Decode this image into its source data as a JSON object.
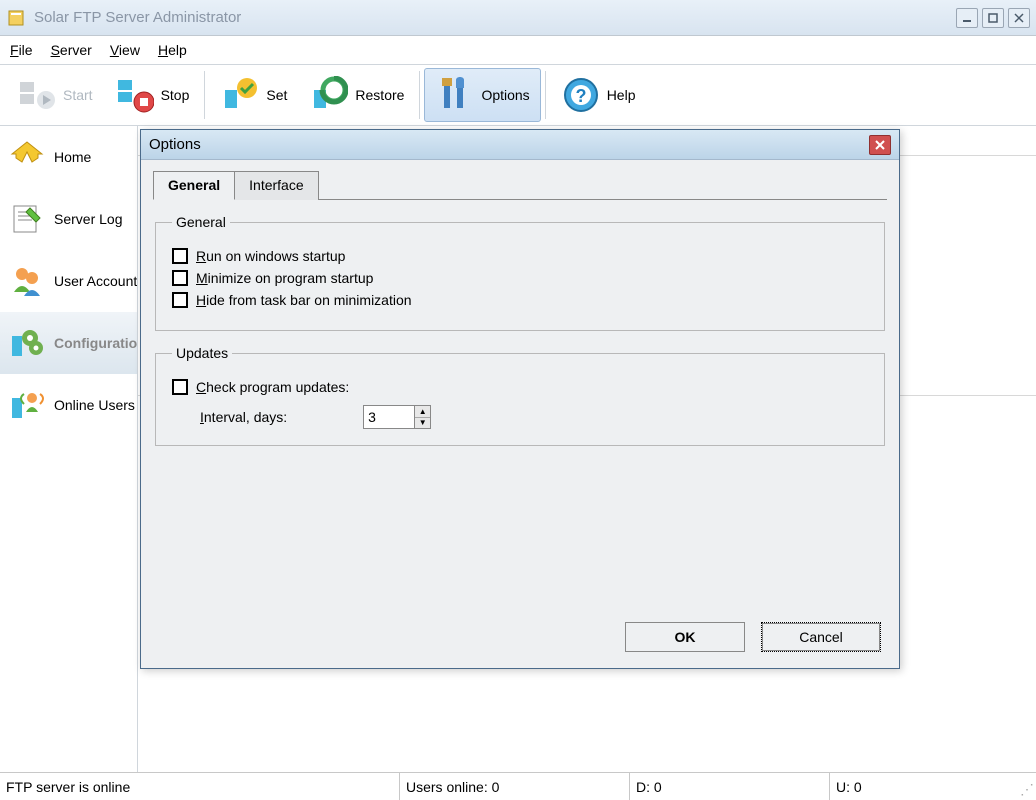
{
  "window": {
    "title": "Solar FTP Server Administrator"
  },
  "menu": {
    "file": "File",
    "server": "Server",
    "view": "View",
    "help": "Help"
  },
  "toolbar": {
    "start": "Start",
    "stop": "Stop",
    "set": "Set",
    "restore": "Restore",
    "options": "Options",
    "help": "Help"
  },
  "sidebar": {
    "items": [
      {
        "label": "Home"
      },
      {
        "label": "Server Log"
      },
      {
        "label": "User Accounts"
      },
      {
        "label": "Configuration"
      },
      {
        "label": "Online Users"
      }
    ]
  },
  "dialog": {
    "title": "Options",
    "tabs": {
      "general": "General",
      "interface": "Interface"
    },
    "general_group": {
      "legend": "General",
      "run_startup": "Run on windows startup",
      "min_startup": "Minimize on program startup",
      "hide_taskbar": "Hide from task bar on minimization"
    },
    "updates_group": {
      "legend": "Updates",
      "check_updates": "Check program updates:",
      "interval_label": "Interval, days:",
      "interval_value": "3"
    },
    "ok": "OK",
    "cancel": "Cancel"
  },
  "status": {
    "server": "FTP server is online",
    "users": "Users online: 0",
    "d": "D: 0",
    "u": "U: 0"
  }
}
